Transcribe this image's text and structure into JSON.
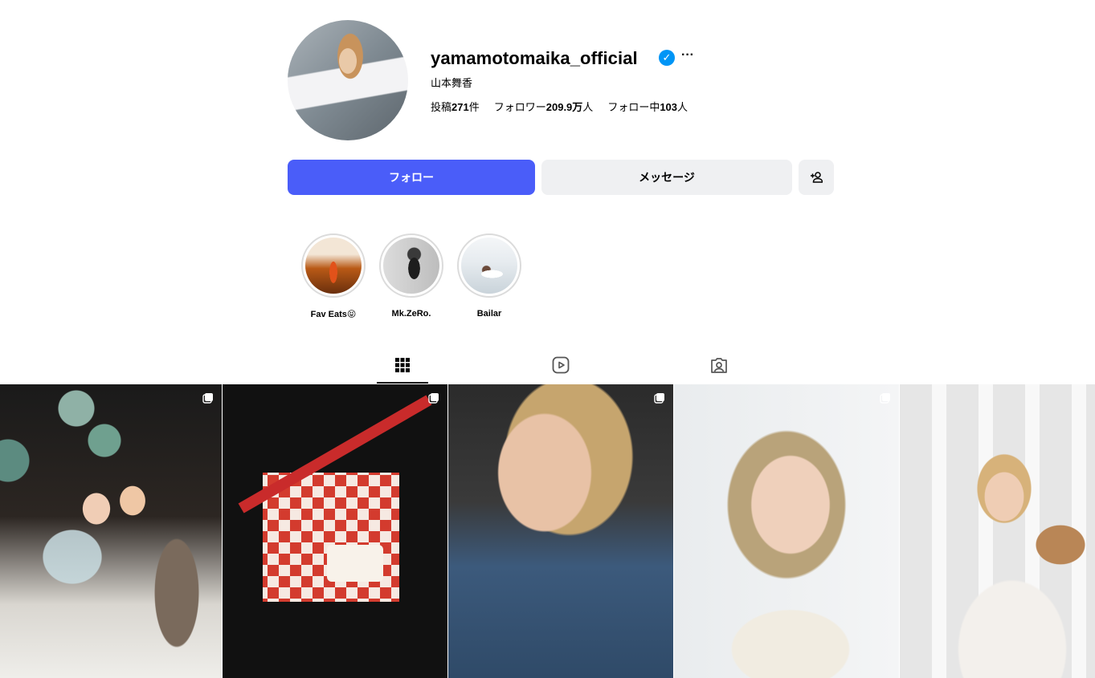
{
  "profile": {
    "username": "yamamotomaika_official",
    "full_name": "山本舞香",
    "more": "···",
    "stats": {
      "posts_prefix": "投稿",
      "posts_value": "271",
      "posts_suffix": "件",
      "followers_prefix": "フォロワー",
      "followers_value": "209.9万",
      "followers_suffix": "人",
      "following_prefix": "フォロー中",
      "following_value": "103",
      "following_suffix": "人"
    }
  },
  "actions": {
    "follow_label": "フォロー",
    "message_label": "メッセージ",
    "add_icon": "person-add-icon"
  },
  "highlights": [
    {
      "label": "Fav Eats😝"
    },
    {
      "label": "Mk.ZeRo."
    },
    {
      "label": "Bailar"
    }
  ],
  "tabs": [
    {
      "icon": "grid-icon",
      "active": true
    },
    {
      "icon": "reels-icon",
      "active": false
    },
    {
      "icon": "tagged-icon",
      "active": false
    }
  ],
  "posts": [
    {
      "icon": "carousel-icon"
    },
    {
      "icon": "carousel-icon"
    },
    {
      "icon": "carousel-icon"
    },
    {
      "icon": "carousel-icon"
    },
    {
      "icon": "none"
    }
  ],
  "colors": {
    "follow_button": "#4a5df9",
    "secondary_button": "#eff0f2",
    "verified": "#0095f6"
  }
}
